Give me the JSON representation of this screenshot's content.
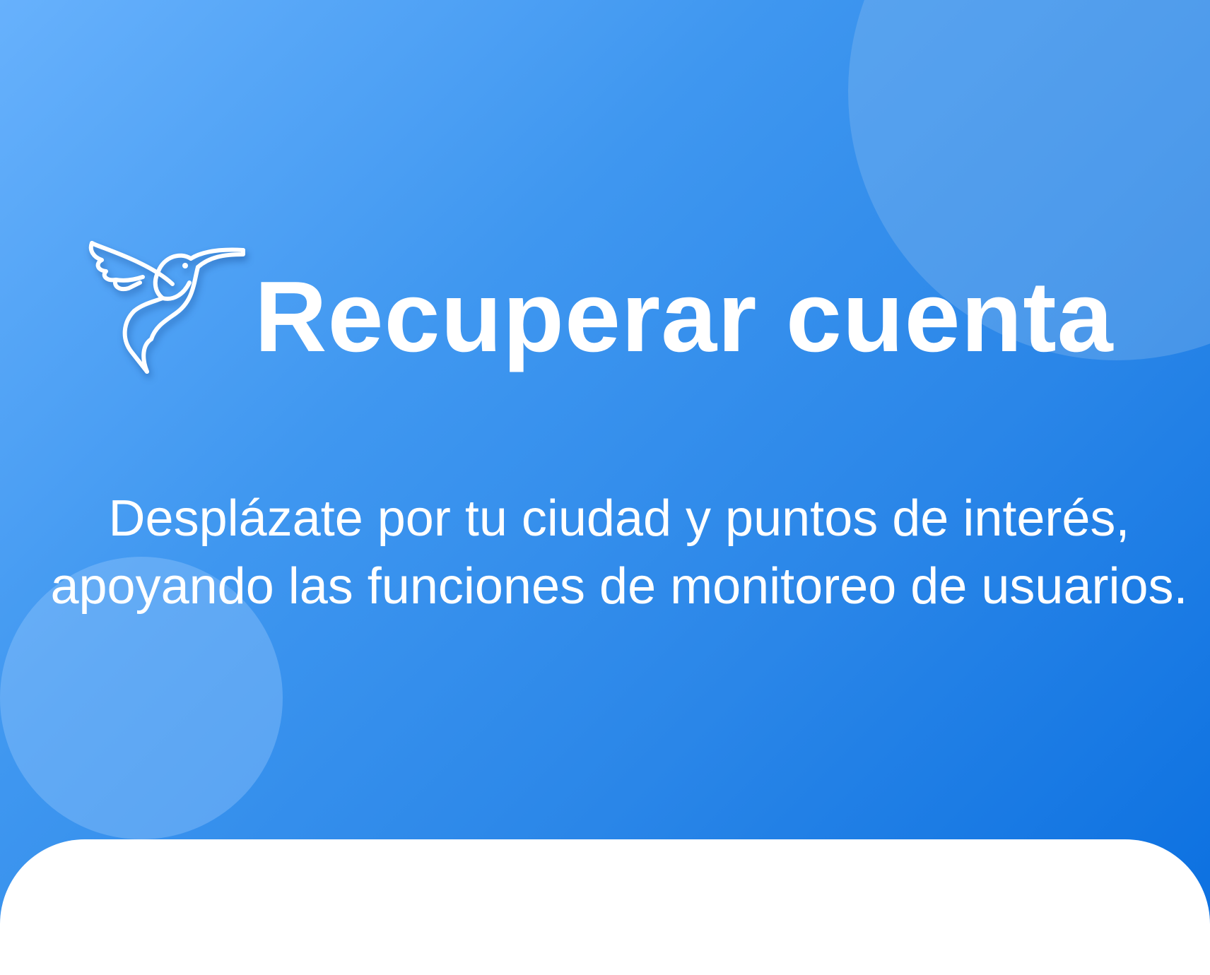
{
  "hero": {
    "title": "Recuperar cuenta",
    "description": "Desplázate por tu ciudad y puntos de interés, apoyando las funciones de monitoreo de usuarios.",
    "logo_icon": "hummingbird-icon",
    "colors": {
      "gradient_start": "#67b1fc",
      "gradient_end": "#0a6fe0",
      "text": "#ffffff",
      "sheet": "#ffffff"
    }
  }
}
